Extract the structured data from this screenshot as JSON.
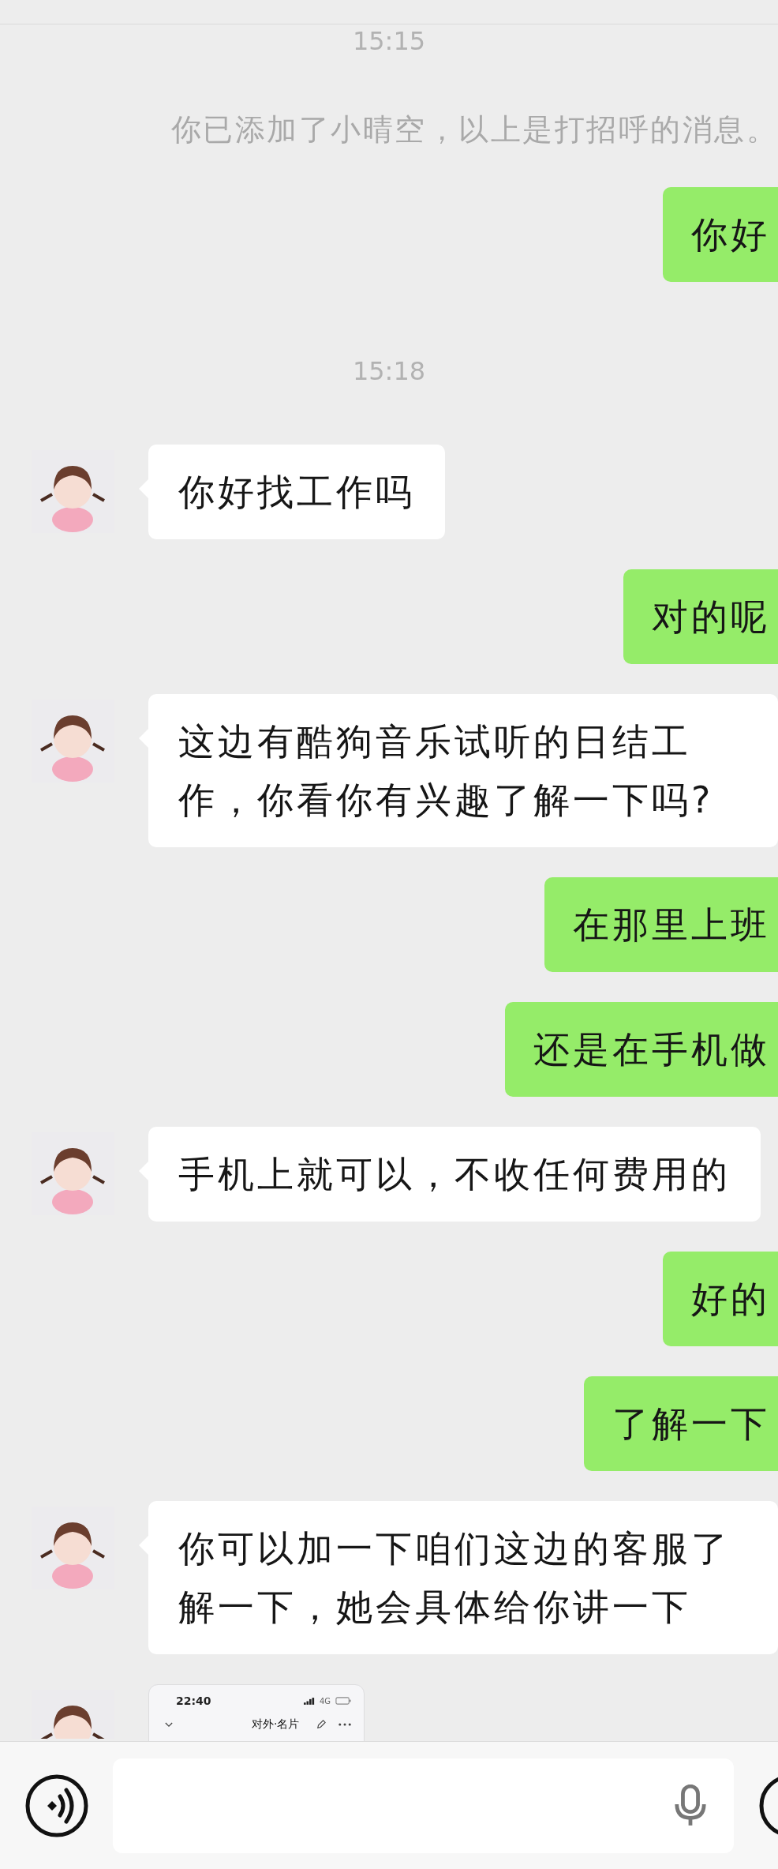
{
  "messages": [
    {
      "kind": "time",
      "text": "15:15"
    },
    {
      "kind": "system",
      "text": "你已添加了小晴空，以上是打招呼的消息。"
    },
    {
      "kind": "sent",
      "text": "你好"
    },
    {
      "kind": "time",
      "text": "15:18"
    },
    {
      "kind": "received",
      "text": "你好找工作吗"
    },
    {
      "kind": "sent",
      "text": "对的呢"
    },
    {
      "kind": "received",
      "text": "这边有酷狗音乐试听的日结工作，你看你有兴趣了解一下吗?"
    },
    {
      "kind": "sent",
      "text": "在那里上班"
    },
    {
      "kind": "sent",
      "text": "还是在手机做"
    },
    {
      "kind": "received",
      "text": "手机上就可以，不收任何费用的"
    },
    {
      "kind": "sent",
      "text": "好的"
    },
    {
      "kind": "sent",
      "text": "了解一下"
    },
    {
      "kind": "received",
      "text": "你可以加一下咱们这边的客服了解一下，她会具体给你讲一下"
    },
    {
      "kind": "received_image",
      "image": {
        "status_time": "22:40",
        "network": "4G",
        "title": "对外·名片"
      }
    }
  ]
}
